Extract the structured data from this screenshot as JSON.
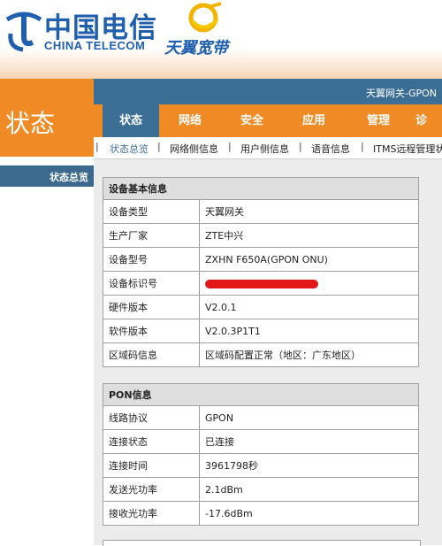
{
  "header": {
    "brand_cn": "中国电信",
    "brand_en": "CHINA TELECOM",
    "broadband_name": "天翼宽带",
    "brand_color": "#1f5fae",
    "accent_color": "#f08a24"
  },
  "sidebar": {
    "title": "状态",
    "active_item": "状态总览"
  },
  "top_bar": {
    "device_name": "天翼网关-GPON"
  },
  "tabs": [
    {
      "label": "状态",
      "active": true
    },
    {
      "label": "网络",
      "active": false
    },
    {
      "label": "安全",
      "active": false
    },
    {
      "label": "应用",
      "active": false
    },
    {
      "label": "管理",
      "active": false
    },
    {
      "label": "诊",
      "active": false
    }
  ],
  "subnav": [
    {
      "label": "状态总览",
      "active": true
    },
    {
      "label": "网络侧信息",
      "active": false
    },
    {
      "label": "用户侧信息",
      "active": false
    },
    {
      "label": "语音信息",
      "active": false
    },
    {
      "label": "ITMS远程管理状",
      "active": false
    }
  ],
  "device_info": {
    "title": "设备基本信息",
    "rows": [
      {
        "key": "设备类型",
        "value": "天翼网关"
      },
      {
        "key": "生产厂家",
        "value": "ZTE中兴"
      },
      {
        "key": "设备型号",
        "value": "ZXHN  F650A(GPON  ONU)"
      },
      {
        "key": "设备标识号",
        "value": ""
      },
      {
        "key": "硬件版本",
        "value": "V2.0.1"
      },
      {
        "key": "软件版本",
        "value": "V2.0.3P1T1"
      },
      {
        "key": "区域码信息",
        "value": "区域码配置正常（地区：广东地区）"
      }
    ]
  },
  "pon_info": {
    "title": "PON信息",
    "rows": [
      {
        "key": "线路协议",
        "value": "GPON"
      },
      {
        "key": "连接状态",
        "value": "已连接"
      },
      {
        "key": "连接时间",
        "value": "3961798秒"
      },
      {
        "key": "发送光功率",
        "value": "2.1dBm"
      },
      {
        "key": "接收光功率",
        "value": "-17.6dBm"
      }
    ]
  }
}
